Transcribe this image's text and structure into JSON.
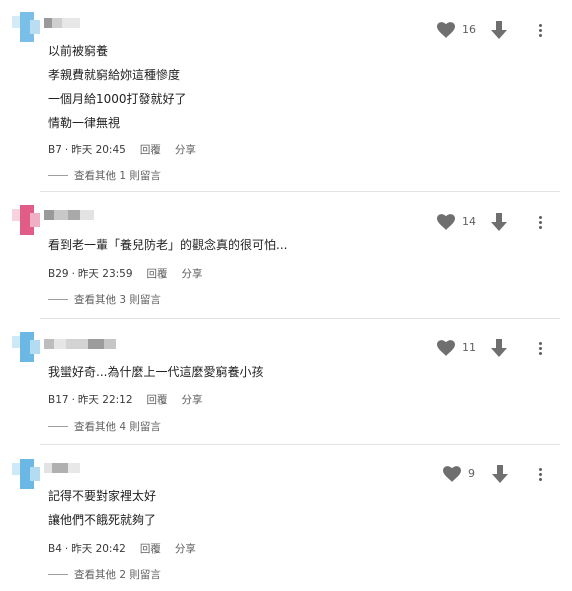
{
  "colors": {
    "avatar_blue": "#6cb8e4",
    "avatar_pink": "#e25c88",
    "icon_gray": "#6f6f6f"
  },
  "reply_label": "回覆",
  "share_label": "分享",
  "comments": [
    {
      "avatar_color": "blue",
      "lines": [
        "以前被窮養",
        "孝親費就窮給妳這種慘度",
        "一個月給1000打發就好了",
        "情勒一律無視"
      ],
      "floor": "B7",
      "time": "昨天 20:45",
      "likes": "16",
      "replies": "查看其他 1 則留言"
    },
    {
      "avatar_color": "pink",
      "lines": [
        "看到老一輩「養兒防老」的觀念真的很可怕..."
      ],
      "floor": "B29",
      "time": "昨天 23:59",
      "likes": "14",
      "replies": "查看其他 3 則留言"
    },
    {
      "avatar_color": "blue",
      "lines": [
        "我蠻好奇...為什麼上一代這麼愛窮養小孩"
      ],
      "floor": "B17",
      "time": "昨天 22:12",
      "likes": "11",
      "replies": "查看其他 4 則留言"
    },
    {
      "avatar_color": "blue",
      "lines": [
        "記得不要對家裡太好",
        "讓他們不餓死就夠了"
      ],
      "floor": "B4",
      "time": "昨天 20:42",
      "likes": "9",
      "replies": "查看其他 2 則留言"
    }
  ]
}
